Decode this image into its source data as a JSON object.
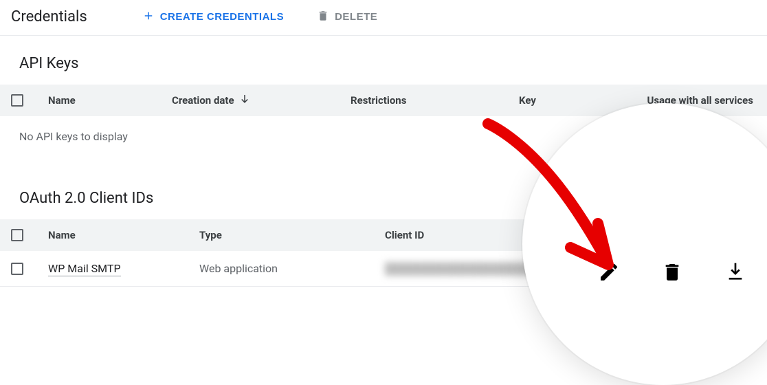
{
  "header": {
    "title": "Credentials",
    "create_label": "CREATE CREDENTIALS",
    "delete_label": "DELETE"
  },
  "api_keys": {
    "title": "API Keys",
    "columns": {
      "name": "Name",
      "creation_date": "Creation date",
      "restrictions": "Restrictions",
      "key": "Key",
      "usage": "Usage with all services"
    },
    "empty_message": "No API keys to display"
  },
  "oauth": {
    "title": "OAuth 2.0 Client IDs",
    "columns": {
      "name": "Name",
      "type": "Type",
      "client_id": "Client ID"
    },
    "rows": [
      {
        "name": "WP Mail SMTP",
        "type": "Web application",
        "client_id": "████████████████████"
      }
    ]
  }
}
